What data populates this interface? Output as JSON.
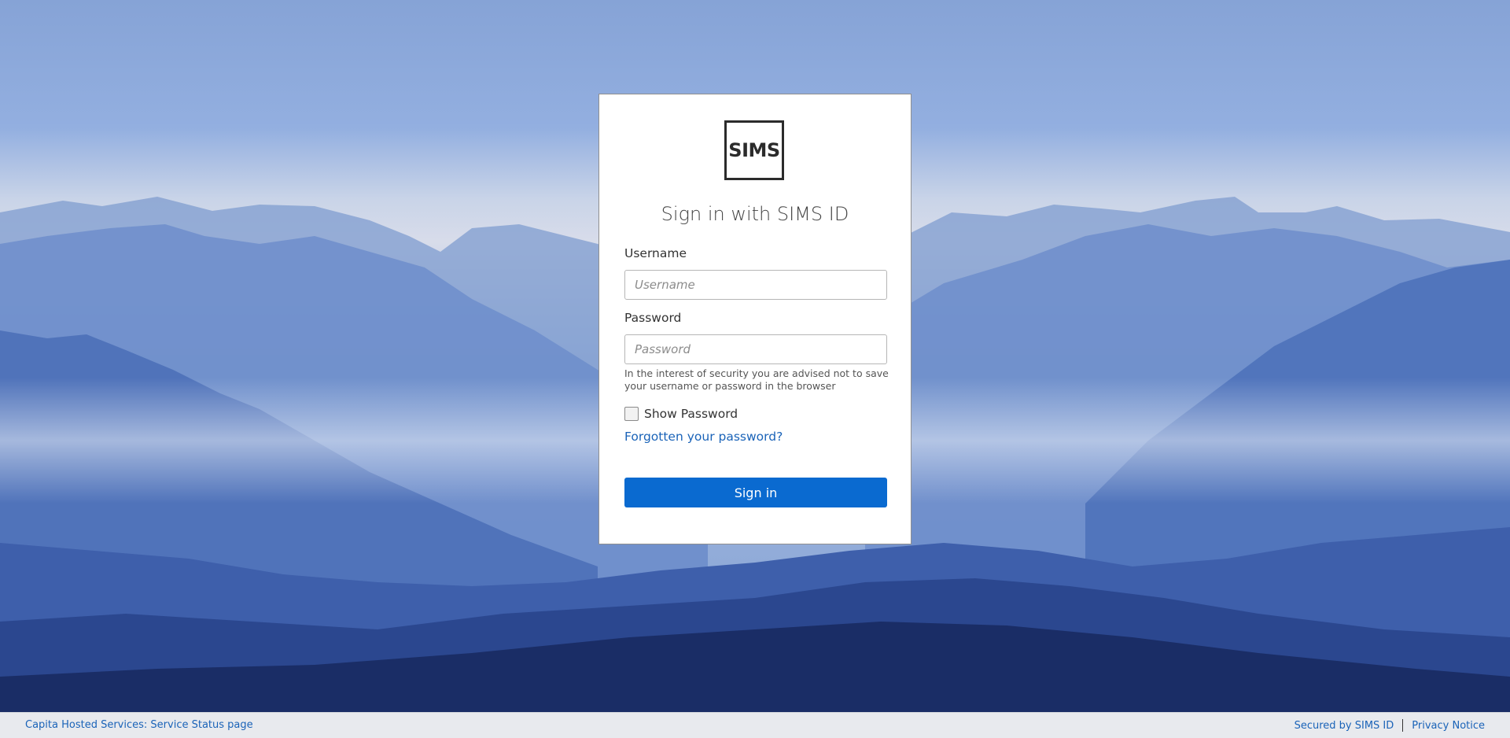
{
  "logo": {
    "text": "SIMS"
  },
  "login": {
    "title": "Sign in with SIMS ID",
    "username_label": "Username",
    "username_placeholder": "Username",
    "username_value": "",
    "password_label": "Password",
    "password_placeholder": "Password",
    "password_value": "",
    "security_hint": "In the interest of security you are advised not to save your username or password in the browser",
    "show_password_label": "Show Password",
    "show_password_checked": false,
    "forgot_link": "Forgotten your password?",
    "signin_button": "Sign in"
  },
  "footer": {
    "service_status_link": "Capita Hosted Services: Service Status page",
    "secured_by_link": "Secured by SIMS ID",
    "privacy_link": "Privacy Notice"
  },
  "colors": {
    "accent": "#0a6ad0",
    "link": "#1a63b8",
    "footer_bg": "#e8eaee",
    "sky_top": "#8aa8d8",
    "mountain_dark": "#1a2d66"
  }
}
